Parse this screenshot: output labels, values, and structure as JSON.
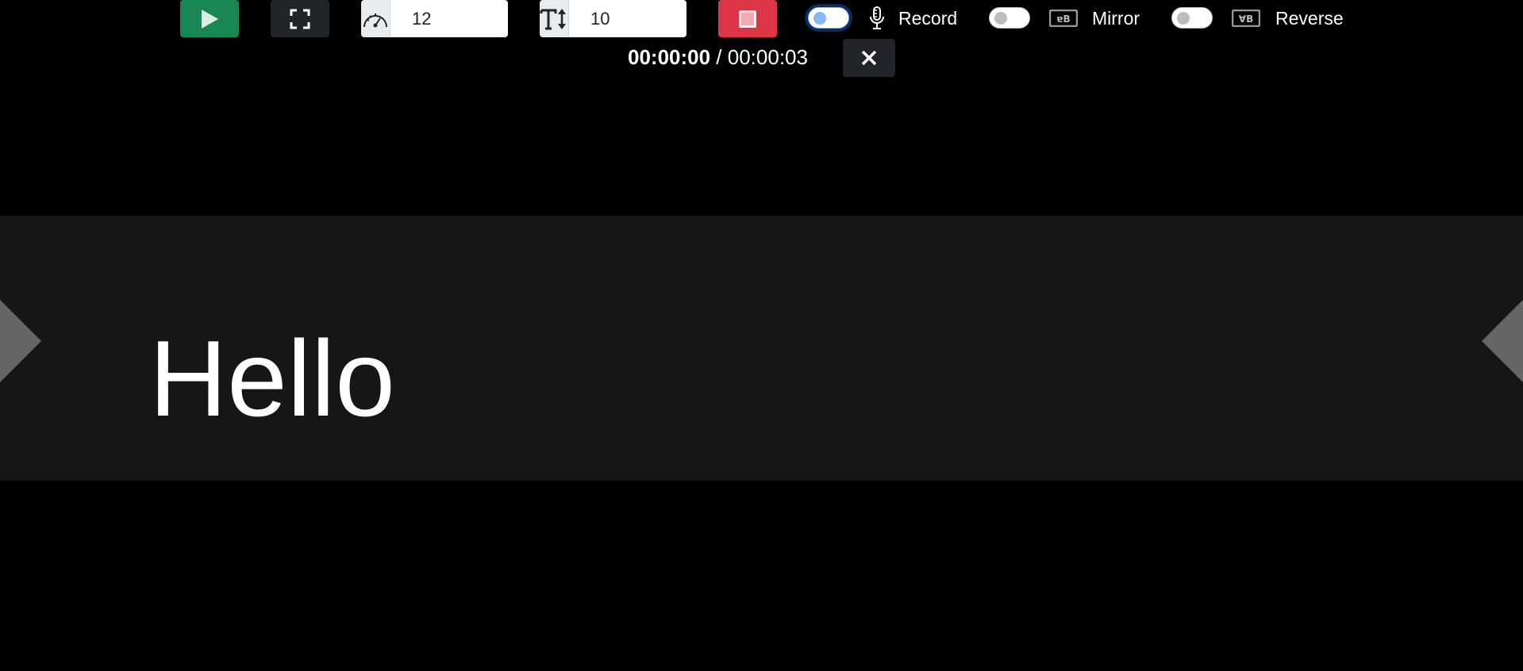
{
  "toolbar": {
    "play_icon": "play-icon",
    "fullscreen_icon": "fullscreen-icon",
    "speed": {
      "icon": "speedometer-icon",
      "value": "12"
    },
    "font_size": {
      "icon": "text-height-icon",
      "value": "10"
    },
    "stop_icon": "stop-icon",
    "record": {
      "label": "Record",
      "checked": true,
      "icon": "microphone-icon"
    },
    "mirror": {
      "label": "Mirror",
      "checked": false,
      "icon": "mirror-icon"
    },
    "reverse": {
      "label": "Reverse",
      "checked": false,
      "icon": "reverse-icon"
    },
    "close_icon": "close-icon"
  },
  "timer": {
    "current": "00:00:00",
    "separator": " / ",
    "total": "00:00:03"
  },
  "stage": {
    "text": "Hello"
  },
  "colors": {
    "play": "#198754",
    "stop": "#dc3545",
    "dark_button": "#212529",
    "stage_background": "#161616",
    "marker": "#666666"
  }
}
